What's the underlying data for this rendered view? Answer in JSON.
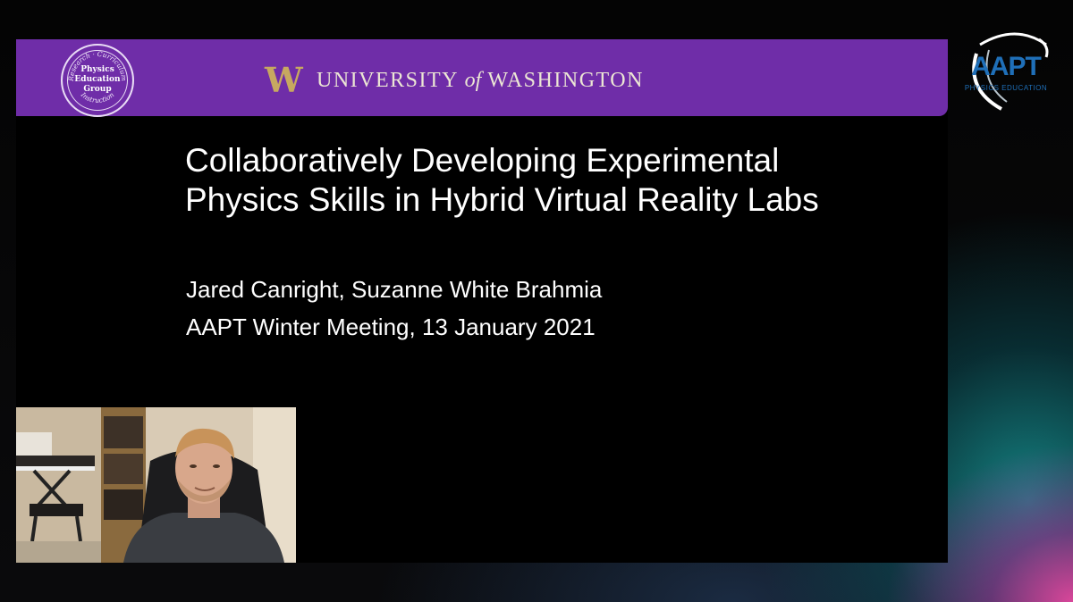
{
  "banner": {
    "seal_text": "Physics\nEducation\nGroup",
    "seal_ring_top": "Research · Curriculum",
    "seal_ring_bottom": "Instruction",
    "uw_logo": "W",
    "uw_name_1": "UNIVERSITY",
    "uw_name_of": "of",
    "uw_name_2": "WASHINGTON",
    "color_purple": "#6f2da8",
    "color_gold": "#c7a860"
  },
  "slide": {
    "title": "Collaboratively Developing Experimental Physics Skills in Hybrid Virtual Reality Labs",
    "authors": "Jared Canright, Suzanne White Brahmia",
    "meeting": "AAPT Winter Meeting, 13 January 2021"
  },
  "overlay": {
    "aapt_logo_text": "AAPT",
    "aapt_logo_sub": "PHYSICS EDUCATION"
  },
  "webcam": {
    "icon": "presenter-video-icon"
  }
}
